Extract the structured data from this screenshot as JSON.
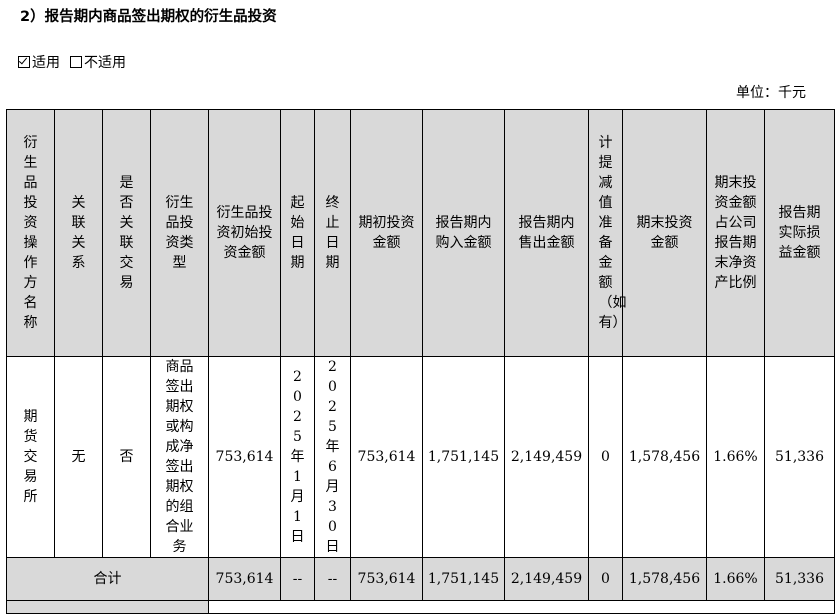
{
  "heading": "2）报告期内商品签出期权的衍生品投资",
  "applicability": {
    "applicable": "适用",
    "not_applicable": "不适用",
    "checked": "applicable"
  },
  "unit": "单位：千元",
  "columns": [
    "衍生品投资操作方名称",
    "关联关系",
    "是否关联交易",
    "衍生品投资类型",
    "衍生品投资初始投资金额",
    "起始日期",
    "终止日期",
    "期初投资金额",
    "报告期内购入金额",
    "报告期内售出金额",
    "计提减值准备金额（如有）",
    "期末投资金额",
    "期末投资金额占公司报告期末净资产比例",
    "报告期实际损益金额"
  ],
  "row": {
    "operator": "期货交易所",
    "relation": "无",
    "related_transaction": "否",
    "type": "商品签出期权或构成净签出期权的组合业务",
    "initial_amount": "753,614",
    "start_date": "2025年1月1日",
    "end_date": "2025年6月30日",
    "opening_amount": "753,614",
    "purchased": "1,751,145",
    "sold": "2,149,459",
    "impairment": "0",
    "closing_amount": "1,578,456",
    "ratio": "1.66%",
    "pnl": "51,336"
  },
  "total": {
    "label": "合计",
    "initial_amount": "753,614",
    "start_date": "--",
    "end_date": "--",
    "opening_amount": "753,614",
    "purchased": "1,751,145",
    "sold": "2,149,459",
    "impairment": "0",
    "closing_amount": "1,578,456",
    "ratio": "1.66%",
    "pnl": "51,336"
  }
}
